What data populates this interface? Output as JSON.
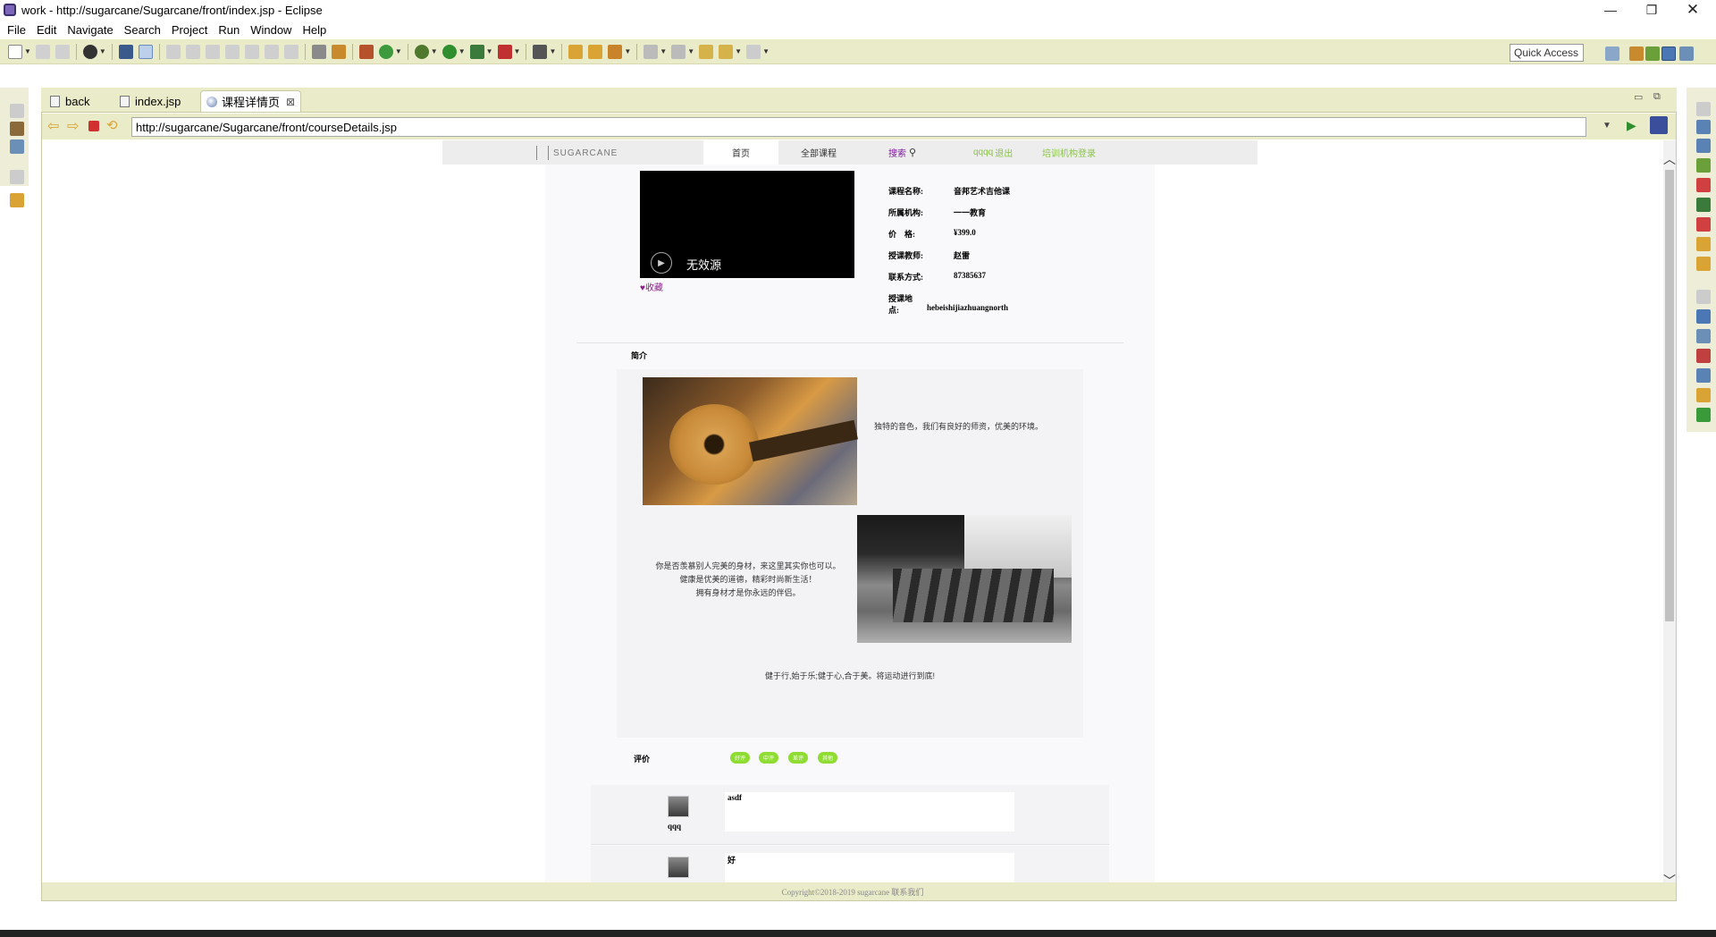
{
  "window": {
    "title": "work - http://sugarcane/Sugarcane/front/index.jsp - Eclipse"
  },
  "menu": [
    "File",
    "Edit",
    "Navigate",
    "Search",
    "Project",
    "Run",
    "Window",
    "Help"
  ],
  "toolbar": {
    "quick_access": "Quick Access"
  },
  "tabs": [
    {
      "label": "back",
      "icon": "file-icon",
      "active": false
    },
    {
      "label": "index.jsp",
      "icon": "jsp-file-icon",
      "active": false
    },
    {
      "label": "课程详情页",
      "icon": "globe-icon",
      "active": true
    }
  ],
  "browser": {
    "url": "http://sugarcane/Sugarcane/front/courseDetails.jsp"
  },
  "site": {
    "logo": "SUGARCANE",
    "nav": {
      "home": "首页",
      "all_courses": "全部课程",
      "search": "搜索",
      "user": "qqqq",
      "logout": "退出",
      "org_login": "培训机构登录"
    },
    "video": {
      "status": "无效源"
    },
    "favorite": "♥收藏",
    "details": [
      {
        "label": "课程名称:",
        "value": "音邦艺术吉他课"
      },
      {
        "label": "所属机构:",
        "value": "一一教育"
      },
      {
        "label": "价　格:",
        "value": "¥399.0"
      },
      {
        "label": "授课教师:",
        "value": "赵雷"
      },
      {
        "label": "联系方式:",
        "value": "87385637"
      },
      {
        "label": "授课地点:",
        "value": "hebeishijiazhuangnorth"
      }
    ],
    "intro_heading": "简介",
    "intro_text1": "独特的音色，我们有良好的师资，优美的环境。",
    "intro_text2_lines": [
      "你是否羡慕别人完美的身材，来这里其实你也可以。",
      "健康是优美的道德，精彩时尚新生活！",
      "拥有身材才是你永远的伴侣。"
    ],
    "intro_text3": "健于行,始于乐;健于心,合于美。将运动进行到底!",
    "review_heading": "评价",
    "review_tags": [
      "好评",
      "中评",
      "差评",
      "其他"
    ],
    "reviews": [
      {
        "user": "qqq",
        "text": "asdf"
      },
      {
        "user": "",
        "text": "好"
      }
    ],
    "footer": "Copyright©2018-2019   sugarcane   联系我们"
  }
}
